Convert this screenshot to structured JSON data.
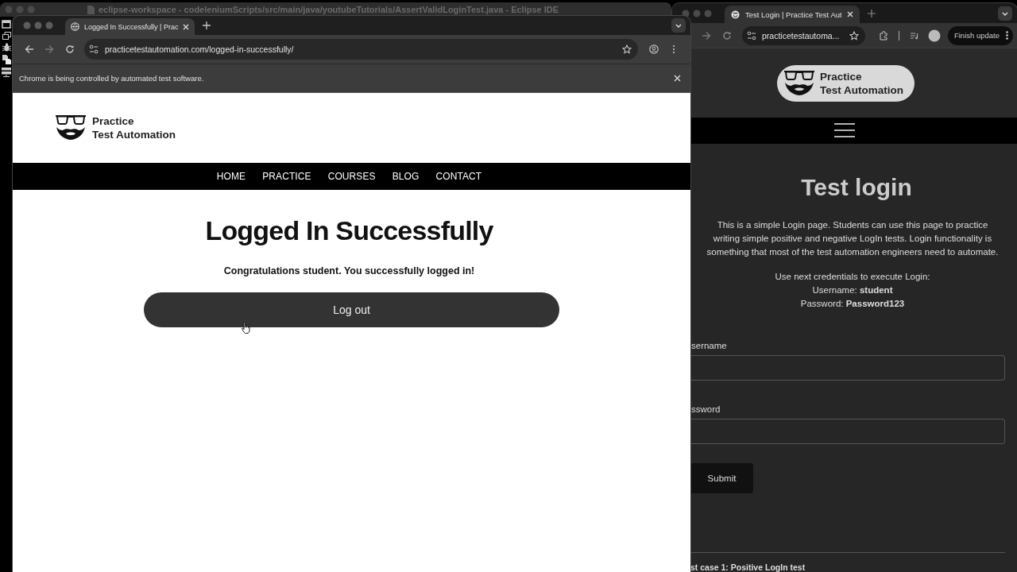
{
  "eclipse_window": {
    "title": "eclipse-workspace - codeleniumScripts/src/main/java/youtubeTutorials/AssertValidLoginTest.java - Eclipse IDE"
  },
  "front_browser": {
    "tab": {
      "title": "Logged In Successfully | Prac"
    },
    "address_bar": {
      "url": "practicetestautomation.com/logged-in-successfully/"
    },
    "infobar": {
      "message": "Chrome is being controlled by automated test software."
    },
    "page": {
      "logo": [
        "Practice",
        "Test Automation"
      ],
      "nav": [
        {
          "label": "HOME"
        },
        {
          "label": "PRACTICE"
        },
        {
          "label": "COURSES"
        },
        {
          "label": "BLOG"
        },
        {
          "label": "CONTACT"
        }
      ],
      "heading": "Logged In Successfully",
      "message": "Congratulations student. You successfully logged in!",
      "logout_button": "Log out"
    }
  },
  "back_browser": {
    "tab": {
      "title": "Test Login | Practice Test Aut"
    },
    "address_bar": {
      "url": "practicetestautoma..."
    },
    "update_button": "Finish update",
    "page": {
      "logo": [
        "Practice",
        "Test Automation"
      ],
      "heading": "Test login",
      "description": "This is a simple Login page. Students can use this page to practice writing simple positive and negative LogIn tests. Login functionality is something that most of the test automation engineers need to automate.",
      "credentials": [
        "Use next credentials to execute Login:",
        "Username: **student**",
        "Password: **Password123**"
      ],
      "fields": [
        {
          "label": "sername"
        },
        {
          "label": "ssword"
        }
      ],
      "submit_button": "Submit",
      "section_heading": "st case 1: Positive LogIn test"
    }
  }
}
